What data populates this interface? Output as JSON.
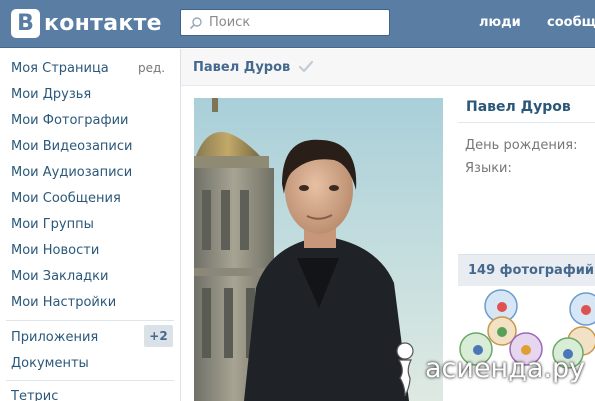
{
  "header": {
    "logo_badge": "B",
    "logo_text": "контакте",
    "search": {
      "placeholder": "Поиск"
    },
    "links": [
      "люди",
      "сообщ"
    ]
  },
  "sidebar": {
    "items": [
      "Моя Страница",
      "Мои Друзья",
      "Мои Фотографии",
      "Мои Видеозаписи",
      "Мои Аудиозаписи",
      "Мои Сообщения",
      "Мои Группы",
      "Мои Новости",
      "Мои Закладки",
      "Мои Настройки"
    ],
    "edit_label": "ред.",
    "apps": "Приложения",
    "apps_badge": "+2",
    "docs": "Документы",
    "tetris": "Тетрис"
  },
  "profile": {
    "header_name": "Павел Дуров",
    "name": "Павел Дуров",
    "birthday_label": "День рождения:",
    "languages_label": "Языки:",
    "photos_count": "149 фотографий"
  },
  "watermark": {
    "text": "асиенда.ру"
  },
  "colors": {
    "header_bg": "#597da3",
    "link": "#2b587a",
    "accent": "#45688e"
  }
}
